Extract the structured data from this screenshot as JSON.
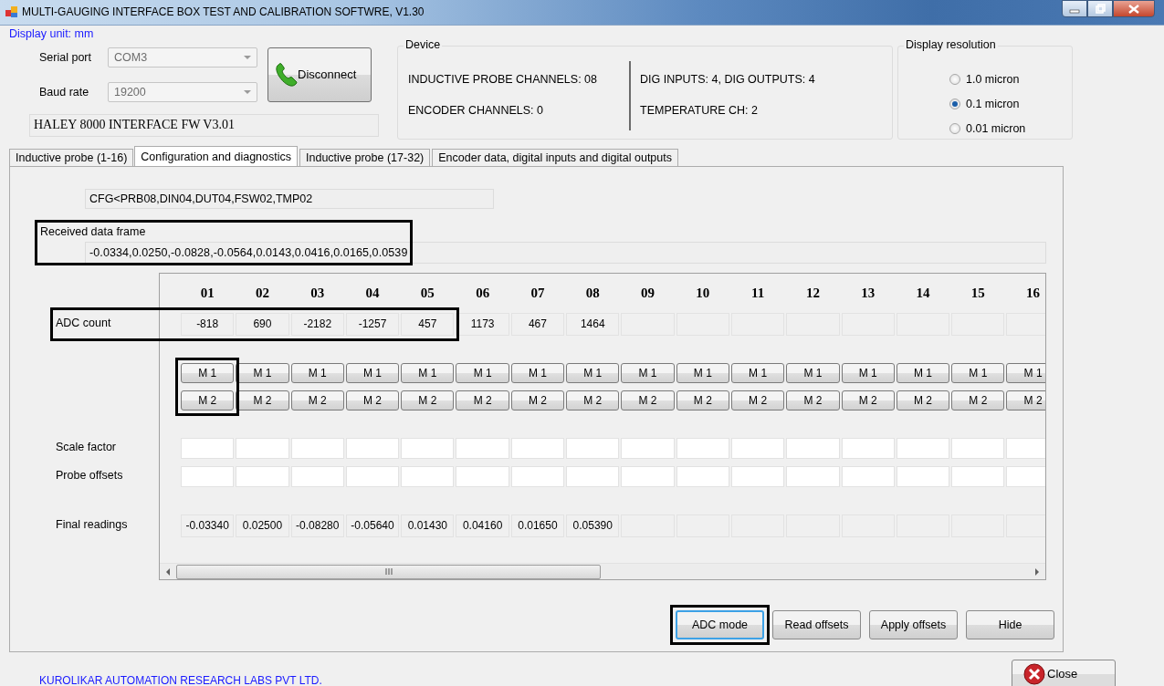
{
  "window": {
    "title": "MULTI-GAUGING INTERFACE BOX TEST AND CALIBRATION SOFTWRE, V1.30"
  },
  "display_unit": "Display unit: mm",
  "connection": {
    "fields": [
      {
        "label": "Serial port",
        "value": "COM3",
        "disabled": true
      },
      {
        "label": "Baud rate",
        "value": "19200",
        "disabled": true
      }
    ],
    "connect_button": "Disconnect",
    "firmware": "HALEY 8000 INTERFACE FW V3.01"
  },
  "device": {
    "title": "Device",
    "info": [
      "INDUCTIVE PROBE CHANNELS: 08",
      "ENCODER CHANNELS: 0",
      "DIG INPUTS: 4, DIG OUTPUTS: 4",
      "TEMPERATURE CH: 2"
    ]
  },
  "resolution": {
    "title": "Display resolution",
    "options": [
      {
        "label": "1.0 micron",
        "selected": false
      },
      {
        "label": "0.1 micron",
        "selected": true
      },
      {
        "label": "0.01 micron",
        "selected": false
      }
    ]
  },
  "tabs": [
    {
      "label": "Inductive probe (1-16)",
      "selected": false
    },
    {
      "label": "Configuration and diagnostics",
      "selected": true
    },
    {
      "label": "Inductive probe (17-32)",
      "selected": false
    },
    {
      "label": "Encoder data, digital inputs and digital outputs",
      "selected": false
    }
  ],
  "config_string": "CFG<PRB08,DIN04,DUT04,FSW02,TMP02",
  "received_frame": {
    "label": "Received data frame",
    "value": "-0.0334,0.0250,-0.0828,-0.0564,0.0143,0.0416,0.0165,0.0539",
    "highlighted": true
  },
  "grid": {
    "columns": [
      {
        "label": "01",
        "highlighted_readout": true,
        "highlighted_buttons": true
      },
      {
        "label": "02",
        "highlighted_readout": true,
        "highlighted_buttons": false
      },
      {
        "label": "03",
        "highlighted_readout": true,
        "highlighted_buttons": false
      },
      {
        "label": "04",
        "highlighted_readout": true,
        "highlighted_buttons": false
      },
      {
        "label": "05",
        "highlighted_readout": true,
        "highlighted_buttons": false
      },
      {
        "label": "06",
        "highlighted_readout": false,
        "highlighted_buttons": false
      },
      {
        "label": "07",
        "highlighted_readout": false,
        "highlighted_buttons": false
      },
      {
        "label": "08",
        "highlighted_readout": false,
        "highlighted_buttons": false
      },
      {
        "label": "09",
        "highlighted_readout": false,
        "highlighted_buttons": false
      },
      {
        "label": "10",
        "highlighted_readout": false,
        "highlighted_buttons": false
      },
      {
        "label": "11",
        "highlighted_readout": false,
        "highlighted_buttons": false
      },
      {
        "label": "12",
        "highlighted_readout": false,
        "highlighted_buttons": false
      },
      {
        "label": "13",
        "highlighted_readout": false,
        "highlighted_buttons": false
      },
      {
        "label": "14",
        "highlighted_readout": false,
        "highlighted_buttons": false
      },
      {
        "label": "15",
        "highlighted_readout": false,
        "highlighted_buttons": false
      },
      {
        "label": "16",
        "highlighted_readout": false,
        "highlighted_buttons": false
      }
    ],
    "rows": [
      {
        "kind": "readout",
        "label": "ADC count",
        "highlighted": true,
        "values": [
          "-818",
          "690",
          "-2182",
          "-1257",
          "457",
          "1173",
          "467",
          "1464"
        ]
      },
      {
        "kind": "buttons",
        "highlighted": true,
        "values": [
          "M 1",
          "M 1",
          "M 1",
          "M 1",
          "M 1",
          "M 1",
          "M 1",
          "M 1",
          "M 1",
          "M 1",
          "M 1",
          "M 1",
          "M 1",
          "M 1",
          "M 1",
          "M 1"
        ]
      },
      {
        "kind": "buttons",
        "highlighted": true,
        "values": [
          "M 2",
          "M 2",
          "M 2",
          "M 2",
          "M 2",
          "M 2",
          "M 2",
          "M 2",
          "M 2",
          "M 2",
          "M 2",
          "M 2",
          "M 2",
          "M 2",
          "M 2",
          "M 2"
        ]
      },
      {
        "kind": "input",
        "label": "Scale factor",
        "highlighted": false
      },
      {
        "kind": "input",
        "label": "Probe offsets",
        "highlighted": false
      },
      {
        "kind": "readout",
        "label": "Final readings",
        "highlighted": false,
        "values": [
          "-0.03340",
          "0.02500",
          "-0.08280",
          "-0.05640",
          "0.01430",
          "0.04160",
          "0.01650",
          "0.05390"
        ]
      }
    ]
  },
  "actions": [
    {
      "label": "ADC mode",
      "focused": true,
      "highlighted": true
    },
    {
      "label": "Read offsets",
      "focused": false,
      "highlighted": false
    },
    {
      "label": "Apply offsets",
      "focused": false,
      "highlighted": false
    },
    {
      "label": "Hide",
      "focused": false,
      "highlighted": false
    }
  ],
  "footer": "KUROLIKAR AUTOMATION RESEARCH LABS PVT LTD.",
  "close_button": "Close"
}
